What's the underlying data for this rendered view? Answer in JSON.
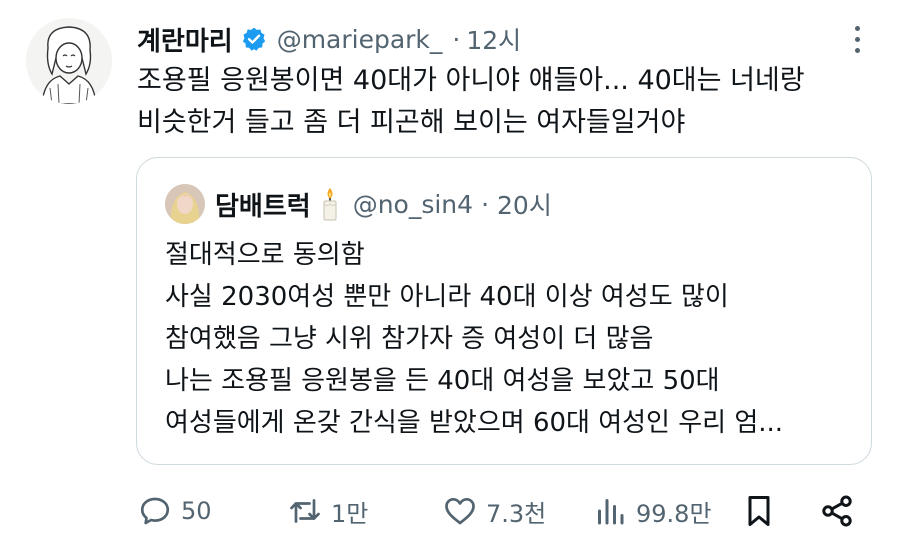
{
  "tweet": {
    "display_name": "계란마리",
    "handle": "@mariepark_",
    "separator": "·",
    "time": "12시",
    "text_lines": [
      "조용필 응원봉이면 40대가 아니야 얘들아... 40대는 너네랑",
      "비슷한거 들고 좀 더 피곤해 보이는 여자들일거야"
    ],
    "verified_color": "#1d9bf0"
  },
  "quoted": {
    "display_name": "담배트럭",
    "handle": "@no_sin4",
    "separator": "·",
    "time": "20시",
    "text_lines": [
      "절대적으로 동의함",
      "사실 2030여성 뿐만 아니라 40대 이상 여성도 많이",
      "참여했음 그냥 시위 참가자 증 여성이 더 많음",
      "나는 조용필 응원봉을 든 40대 여성을 보았고 50대",
      "여성들에게 온갖 간식을 받았으며 60대 여성인 우리 엄..."
    ]
  },
  "actions": {
    "reply_count": "50",
    "retweet_count": "1만",
    "like_count": "7.3천",
    "views_count": "99.8만"
  },
  "icons": [
    "verified-badge-icon",
    "more-icon",
    "candle-icon",
    "reply-icon",
    "retweet-icon",
    "like-icon",
    "views-icon",
    "bookmark-icon",
    "share-icon"
  ],
  "colors": {
    "text": "#0f1419",
    "secondary": "#536471",
    "border": "#cfd9de",
    "verified": "#1d9bf0"
  }
}
